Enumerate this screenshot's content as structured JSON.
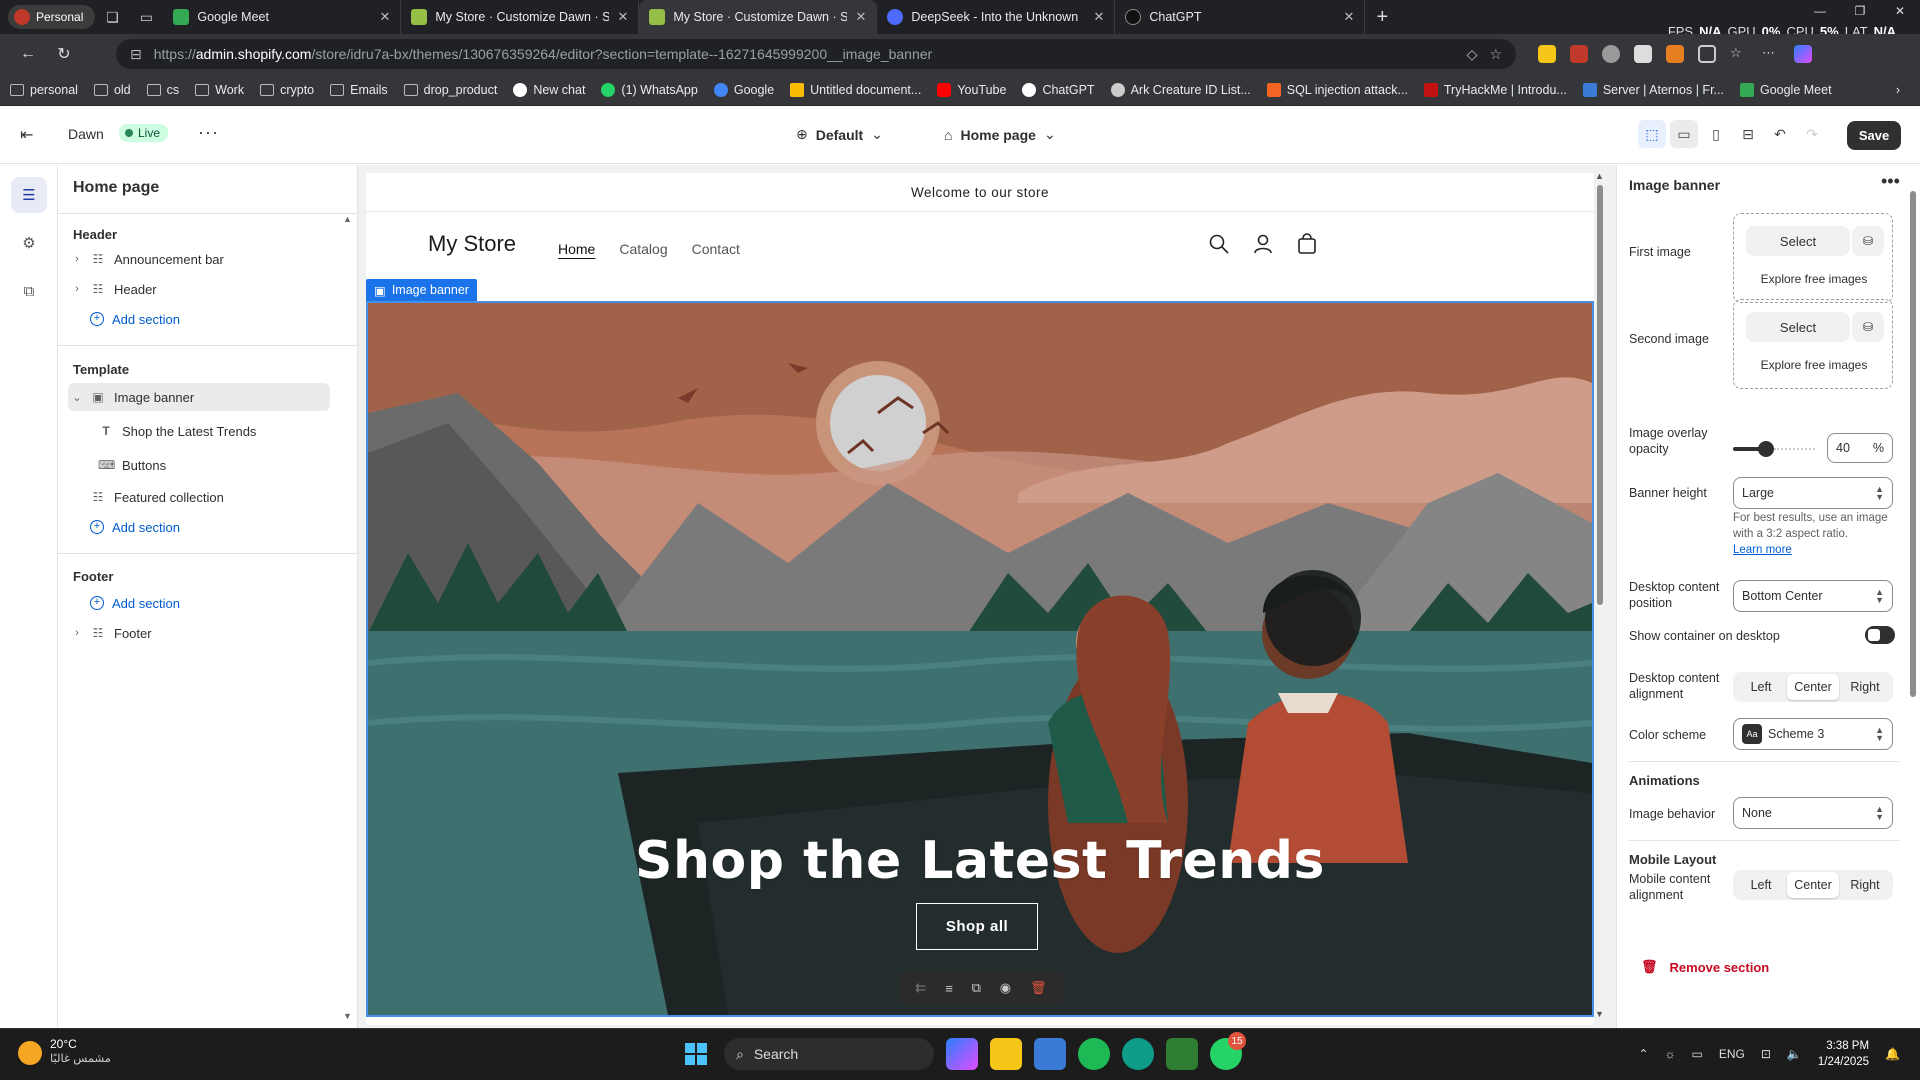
{
  "browser": {
    "profile": "Personal",
    "tabs": [
      {
        "title": "Google Meet",
        "color": "#34a853",
        "active": false
      },
      {
        "title": "My Store · Customize Dawn · Shop",
        "color": "#95bf47",
        "active": false
      },
      {
        "title": "My Store · Customize Dawn · Shop",
        "color": "#95bf47",
        "active": true
      },
      {
        "title": "DeepSeek - Into the Unknown",
        "color": "#4d6bfe",
        "active": false
      },
      {
        "title": "ChatGPT",
        "color": "#202124",
        "active": false
      }
    ],
    "stats": {
      "fps_label": "FPS",
      "fps": "N/A",
      "gpu_label": "GPU",
      "gpu": "0%",
      "cpu_label": "CPU",
      "cpu": "5%",
      "lat_label": "LAT",
      "lat": "N/A"
    },
    "url_host": "admin.shopify.com",
    "url_prefix": "https://",
    "url_path": "/store/idru7a-bx/themes/130676359264/editor?section=template--16271645999200__image_banner",
    "bookmarks": [
      "personal",
      "old",
      "cs",
      "Work",
      "crypto",
      "Emails",
      "drop_product",
      "New chat",
      "(1) WhatsApp",
      "Google",
      "Untitled document...",
      "YouTube",
      "ChatGPT",
      "Ark Creature ID List...",
      "SQL injection attack...",
      "TryHackMe | Introdu...",
      "Server | Aternos | Fr...",
      "Google Meet"
    ]
  },
  "editor": {
    "theme_name": "Dawn",
    "live_badge": "Live",
    "context_default": "Default",
    "context_page": "Home page",
    "save_label": "Save",
    "left": {
      "title": "Home page",
      "header_group": "Header",
      "announcement_bar": "Announcement bar",
      "header_item": "Header",
      "add_section": "Add section",
      "template_group": "Template",
      "image_banner": "Image banner",
      "child_trends": "Shop the Latest Trends",
      "child_buttons": "Buttons",
      "featured_collection": "Featured collection",
      "footer_group": "Footer",
      "footer_item": "Footer"
    },
    "preview": {
      "announcement": "Welcome to our store",
      "store_name": "My Store",
      "nav": [
        "Home",
        "Catalog",
        "Contact"
      ],
      "section_tag": "Image banner",
      "hero_title": "Shop the Latest Trends",
      "hero_button": "Shop all"
    },
    "right": {
      "title": "Image banner",
      "first_image": "First image",
      "second_image": "Second image",
      "select": "Select",
      "explore": "Explore free images",
      "overlay_label": "Image overlay opacity",
      "overlay_value": "40",
      "overlay_unit": "%",
      "overlay_fraction": 0.4,
      "banner_height_label": "Banner height",
      "banner_height": "Large",
      "help_text": "For best results, use an image with a 3:2 aspect ratio.",
      "learn_more": "Learn more",
      "desktop_position_label": "Desktop content position",
      "desktop_position": "Bottom Center",
      "show_container_label": "Show container on desktop",
      "desktop_alignment_label": "Desktop content alignment",
      "align_options": [
        "Left",
        "Center",
        "Right"
      ],
      "color_scheme_label": "Color scheme",
      "color_scheme": "Scheme 3",
      "scheme_chip": "Aa",
      "animations_head": "Animations",
      "image_behavior_label": "Image behavior",
      "image_behavior": "None",
      "mobile_head": "Mobile Layout",
      "mobile_alignment_label": "Mobile content alignment",
      "remove_section": "Remove section"
    }
  },
  "taskbar": {
    "temp": "20°C",
    "weather_desc": "مشمس غالبًا",
    "search": "Search",
    "whatsapp_badge": "15",
    "lang": "ENG",
    "time": "3:38 PM",
    "date": "1/24/2025"
  }
}
